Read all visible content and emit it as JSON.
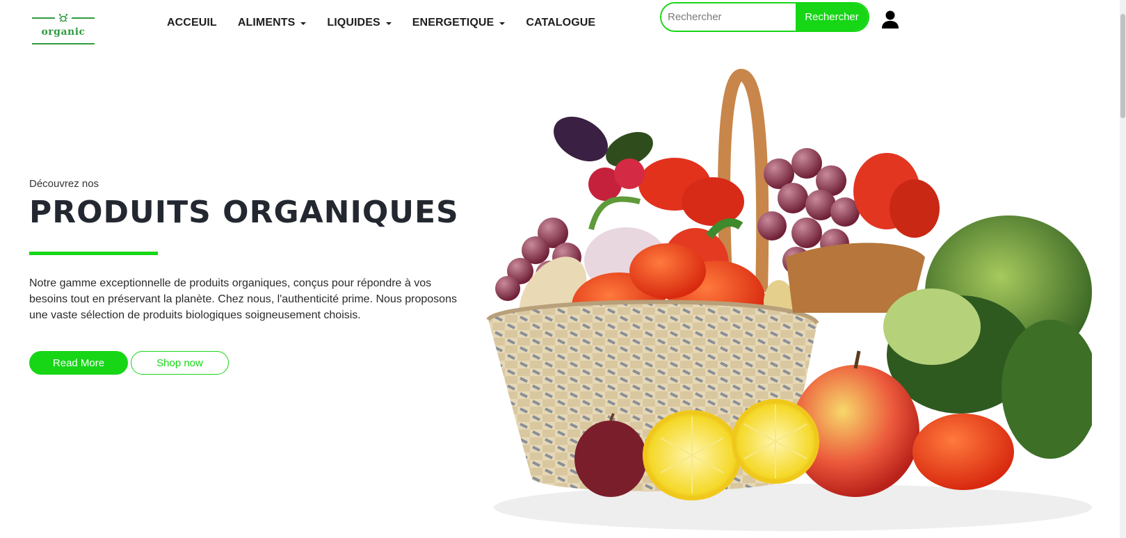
{
  "header": {
    "logo_text": "organic",
    "nav": [
      {
        "label": "ACCEUIL",
        "dropdown": false
      },
      {
        "label": "ALIMENTS",
        "dropdown": true
      },
      {
        "label": "LIQUIDES",
        "dropdown": true
      },
      {
        "label": "ENERGETIQUE",
        "dropdown": true
      },
      {
        "label": "CATALOGUE",
        "dropdown": false
      }
    ],
    "search": {
      "placeholder": "Rechercher",
      "value": "",
      "button_label": "Rechercher"
    },
    "user_icon": "user-icon"
  },
  "hero": {
    "kicker": "Découvrez nos",
    "title": "PRODUITS ORGANIQUES",
    "description": "Notre gamme exceptionnelle de produits organiques, conçus pour répondre à vos besoins tout en préservant la planète. Chez nous, l'authenticité prime. Nous proposons une vaste sélection de produits biologiques soigneusement choisis.",
    "read_more_label": "Read More",
    "shop_now_label": "Shop now",
    "image": "basket-of-fruits-and-vegetables"
  },
  "colors": {
    "accent": "#16d616",
    "logo_green": "#2e9b3f",
    "title": "#232830"
  }
}
